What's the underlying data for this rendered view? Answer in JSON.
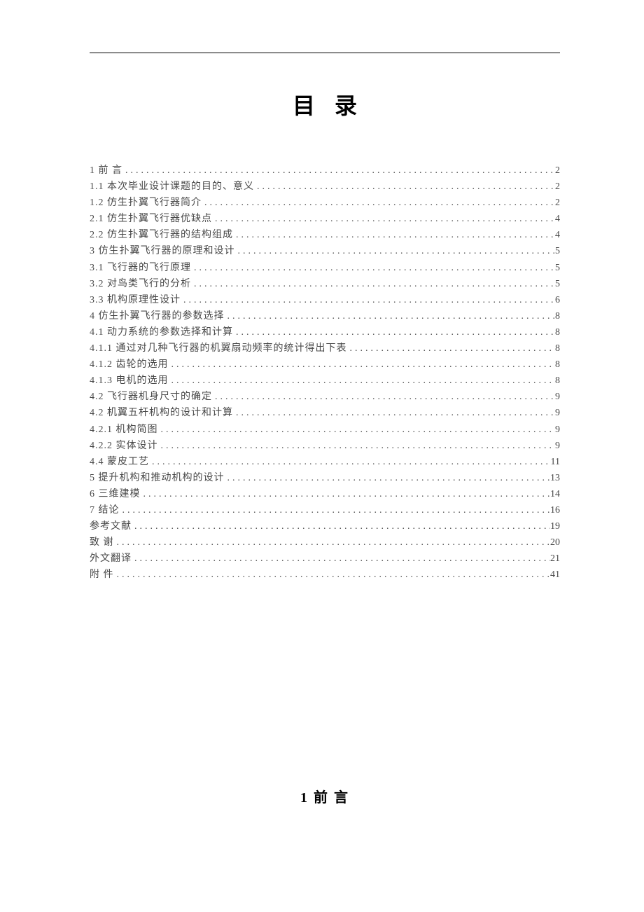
{
  "title": "目录",
  "toc": [
    {
      "label": "1 前 言",
      "page": "2"
    },
    {
      "label": "1.1 本次毕业设计课题的目的、意义",
      "page": "2"
    },
    {
      "label": "1.2 仿生扑翼飞行器简介",
      "page": "2"
    },
    {
      "label": "2.1 仿生扑翼飞行器优缺点",
      "page": "4"
    },
    {
      "label": "2.2 仿生扑翼飞行器的结构组成",
      "page": "4"
    },
    {
      "label": "3 仿生扑翼飞行器的原理和设计",
      "page": "5"
    },
    {
      "label": "3.1 飞行器的飞行原理",
      "page": "5"
    },
    {
      "label": "3.2 对鸟类飞行的分析",
      "page": "5"
    },
    {
      "label": "3.3 机构原理性设计",
      "page": "6"
    },
    {
      "label": "4 仿生扑翼飞行器的参数选择",
      "page": "8"
    },
    {
      "label": "4.1 动力系统的参数选择和计算",
      "page": "8"
    },
    {
      "label": "4.1.1 通过对几种飞行器的机翼扇动频率的统计得出下表",
      "page": "8"
    },
    {
      "label": "4.1.2 齿轮的选用",
      "page": "8"
    },
    {
      "label": "4.1.3 电机的选用",
      "page": "8"
    },
    {
      "label": "4.2 飞行器机身尺寸的确定",
      "page": "9"
    },
    {
      "label": "4.2 机翼五杆机构的设计和计算",
      "page": "9"
    },
    {
      "label": "4.2.1 机构简图",
      "page": "9"
    },
    {
      "label": "4.2.2 实体设计",
      "page": "9"
    },
    {
      "label": "4.4 蒙皮工艺",
      "page": "11"
    },
    {
      "label": "5 提升机构和推动机构的设计",
      "page": "13"
    },
    {
      "label": "6 三维建模",
      "page": "14"
    },
    {
      "label": "7 结论",
      "page": "16"
    },
    {
      "label": "参考文献",
      "page": "19"
    },
    {
      "label": "致 谢",
      "page": "20"
    },
    {
      "label": "外文翻译",
      "page": "21"
    },
    {
      "label": "附  件",
      "page": "41"
    }
  ],
  "section_heading": "1 前 言"
}
